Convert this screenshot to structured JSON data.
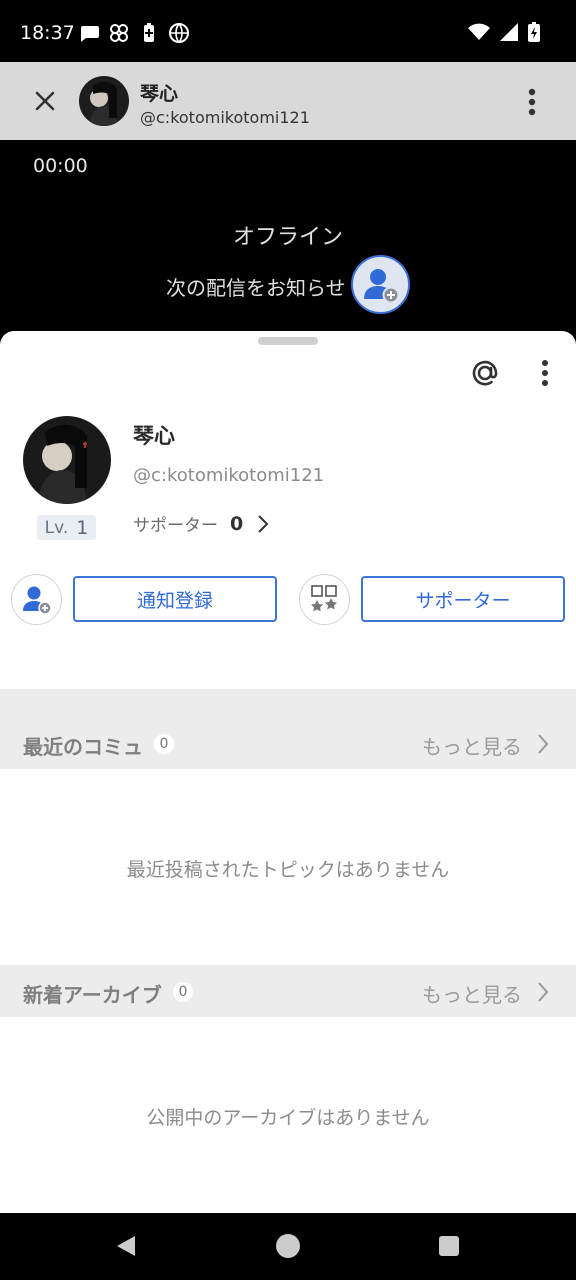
{
  "status_bar": {
    "time": "18:37",
    "left_icons": [
      "chat-bubble-icon",
      "pinwheel-icon",
      "battery-saver-icon",
      "vpn-globe-icon"
    ],
    "right_icons": [
      "wifi-icon",
      "signal-icon",
      "battery-icon"
    ]
  },
  "header": {
    "name": "琴心",
    "handle": "@c:kotomikotomi121"
  },
  "player": {
    "timer": "00:00",
    "status": "オフライン",
    "notify_next": "次の配信をお知らせ"
  },
  "profile": {
    "name": "琴心",
    "handle": "@c:kotomikotomi121",
    "level_label": "Lv.",
    "level_value": "1",
    "supporter_label": "サポーター",
    "supporter_count": "0"
  },
  "actions": {
    "notify_button": "通知登録",
    "supporter_button": "サポーター"
  },
  "sections": {
    "community": {
      "title": "最近のコミュ",
      "count": "0",
      "more": "もっと見る",
      "empty": "最近投稿されたトピックはありません"
    },
    "archive": {
      "title": "新着アーカイブ",
      "count": "0",
      "more": "もっと見る",
      "empty": "公開中のアーカイブはありません"
    }
  },
  "colors": {
    "accent": "#3a74d9",
    "header_bg": "#d9d9d9",
    "section_bg": "#ececec"
  }
}
